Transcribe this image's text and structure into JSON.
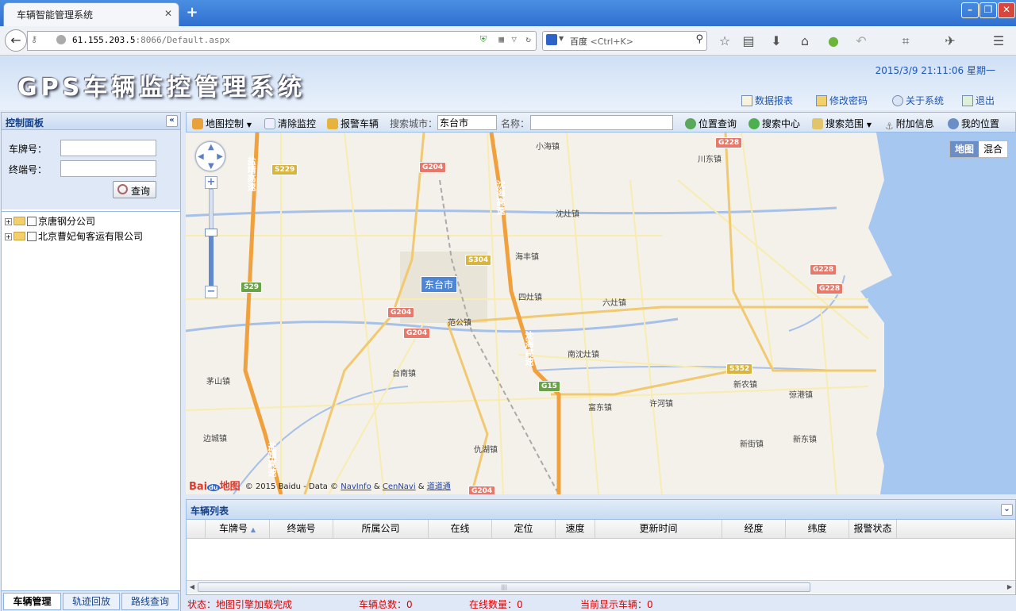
{
  "browser": {
    "tab_title": "车辆智能管理系统",
    "url_host": "61.155.203.5",
    "url_rest": ":8066/Default.aspx",
    "search_engine": "百度",
    "search_placeholder": "<Ctrl+K>"
  },
  "header": {
    "title": "GPS车辆监控管理系统",
    "datetime": "2015/3/9 21:11:06 星期一",
    "links": [
      "数据报表",
      "修改密码",
      "关于系统",
      "退出"
    ]
  },
  "left_panel": {
    "title": "控制面板",
    "plate_label": "车牌号：",
    "terminal_label": "终端号：",
    "plate_value": "",
    "terminal_value": "",
    "query_button": "查询",
    "tree": [
      "京唐钢分公司",
      "北京曹妃甸客运有限公司"
    ],
    "tabs": [
      "车辆管理",
      "轨迹回放",
      "路线查询"
    ]
  },
  "toolbar": {
    "map_control": "地图控制",
    "clear_monitor": "清除监控",
    "alarm_vehicle": "报警车辆",
    "search_city_label": "搜索城市：",
    "search_city_value": "东台市",
    "name_label": "名称：",
    "name_value": "",
    "position_query": "位置查询",
    "search_center": "搜索中心",
    "search_range": "搜索范围",
    "extra_info": "附加信息",
    "my_location": "我的位置"
  },
  "map": {
    "city_tag": "东台市",
    "map_types": [
      "地图",
      "混合"
    ],
    "active_map_type": "地图",
    "towns": [
      "小海镇",
      "川东镇",
      "沈灶镇",
      "海丰镇",
      "四灶镇",
      "六灶镇",
      "范公镇",
      "南沈灶镇",
      "台南镇",
      "茅山镇",
      "富东镇",
      "许河镇",
      "新农镇",
      "弶港镇",
      "边城镇",
      "仇湖镇",
      "新街镇",
      "新东镇"
    ],
    "shields": [
      "G228",
      "S229",
      "G204",
      "S304",
      "G228",
      "G228",
      "S29",
      "G204",
      "G204",
      "S352",
      "G15",
      "G204"
    ],
    "road_names": [
      "盐靖高速",
      "沈海高速",
      "沈海高速",
      "盐靖高速"
    ],
    "copyright": "© 2015 Baidu - Data ©",
    "copyright_links": [
      "NavInfo",
      "CenNavi",
      "道道通"
    ],
    "logo_text": "Bai地图"
  },
  "vehicle_list": {
    "title": "车辆列表",
    "columns": [
      "车牌号",
      "终端号",
      "所属公司",
      "在线",
      "定位",
      "速度",
      "更新时间",
      "经度",
      "纬度",
      "报警状态"
    ]
  },
  "status_bar": {
    "state": "状态：地图引擎加载完成",
    "total": "车辆总数：0",
    "online": "在线数量：0",
    "shown": "当前显示车辆：0"
  },
  "colors": {
    "accent": "#15428b",
    "link": "#1c56b8",
    "status": "#dd0000",
    "expressway": "#f0a03c"
  }
}
